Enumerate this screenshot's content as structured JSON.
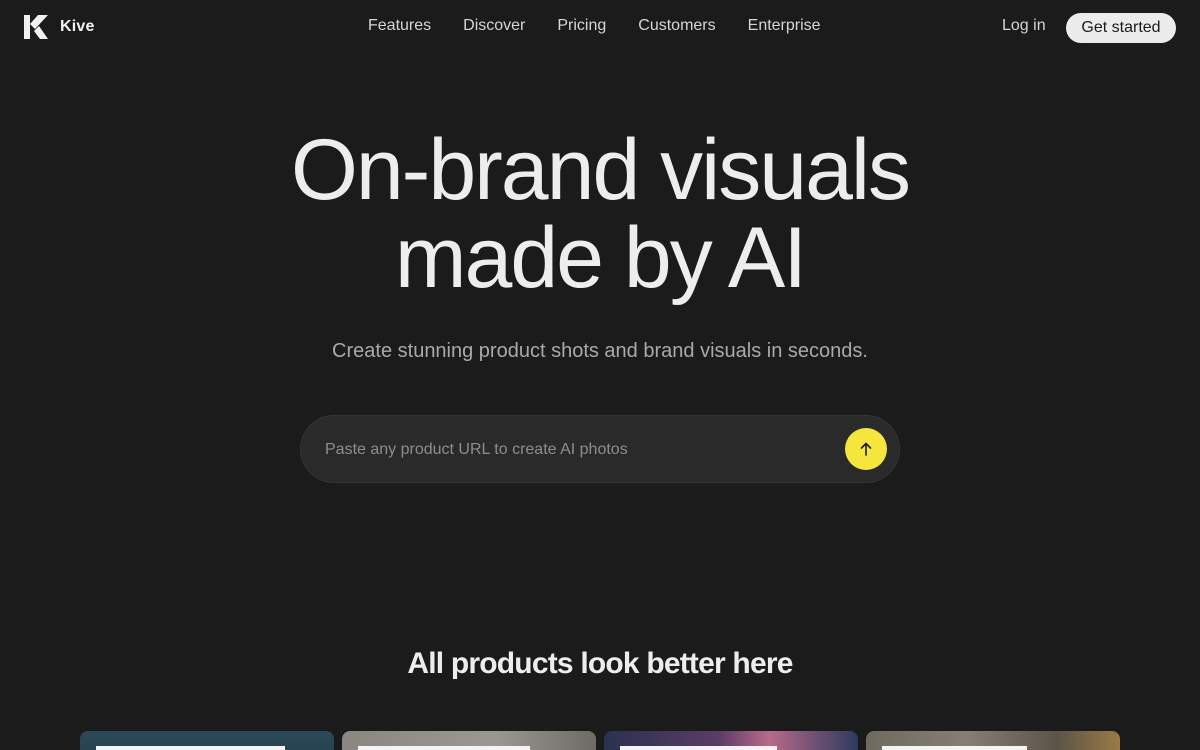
{
  "nav": {
    "brand_name": "Kive",
    "logo_icon": "kive-logo-icon",
    "links": [
      {
        "label": "Features"
      },
      {
        "label": "Discover"
      },
      {
        "label": "Pricing"
      },
      {
        "label": "Customers"
      },
      {
        "label": "Enterprise"
      }
    ],
    "login_label": "Log in",
    "cta_label": "Get started"
  },
  "hero": {
    "title_line1": "On-brand visuals",
    "title_line2": "made by AI",
    "subtitle": "Create stunning product shots and brand visuals in seconds.",
    "url_input": {
      "placeholder": "Paste any product URL to create AI photos",
      "value": ""
    },
    "submit_icon": "arrow-up-icon"
  },
  "showcase": {
    "heading": "All products look better here",
    "cards_visible": 4
  },
  "colors": {
    "background": "#1c1b1c",
    "text": "#ececec",
    "muted_text": "#a9a9a9",
    "input_bg": "#2b2a2b",
    "accent_yellow": "#f5e63d",
    "cta_bg": "#ececec",
    "cta_text": "#1c1b1c"
  }
}
